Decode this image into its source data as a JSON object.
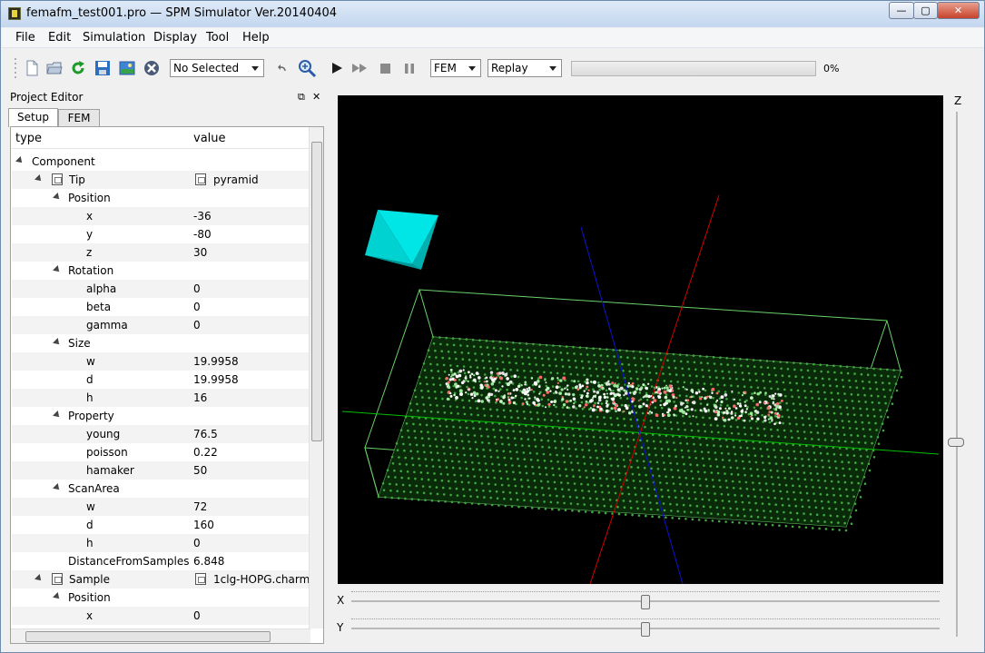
{
  "window": {
    "title": "femafm_test001.pro — SPM Simulator Ver.20140404",
    "minimize": "—",
    "maximize": "▢",
    "close": "✕"
  },
  "menu": [
    "File",
    "Edit",
    "Simulation",
    "Display",
    "Tool",
    "Help"
  ],
  "toolbar": {
    "selection_combo": "No Selected",
    "mode_combo": "FEM",
    "replay_combo": "Replay",
    "progress_percent": 0,
    "progress_label": "0%"
  },
  "project_editor": {
    "title": "Project Editor",
    "float_button": "⧉",
    "close_button": "✕",
    "tabs": [
      "Setup",
      "FEM"
    ],
    "columns": [
      "type",
      "value"
    ],
    "rows": [
      {
        "label": "Component",
        "value": ""
      },
      {
        "label": "Tip",
        "value": "pyramid"
      },
      {
        "label": "Position",
        "value": ""
      },
      {
        "label": "x",
        "value": "-36"
      },
      {
        "label": "y",
        "value": "-80"
      },
      {
        "label": "z",
        "value": "30"
      },
      {
        "label": "Rotation",
        "value": ""
      },
      {
        "label": "alpha",
        "value": "0"
      },
      {
        "label": "beta",
        "value": "0"
      },
      {
        "label": "gamma",
        "value": "0"
      },
      {
        "label": "Size",
        "value": ""
      },
      {
        "label": "w",
        "value": "19.9958"
      },
      {
        "label": "d",
        "value": "19.9958"
      },
      {
        "label": "h",
        "value": "16"
      },
      {
        "label": "Property",
        "value": ""
      },
      {
        "label": "young",
        "value": "76.5"
      },
      {
        "label": "poisson",
        "value": "0.22"
      },
      {
        "label": "hamaker",
        "value": "50"
      },
      {
        "label": "ScanArea",
        "value": ""
      },
      {
        "label": "w",
        "value": "72"
      },
      {
        "label": "d",
        "value": "160"
      },
      {
        "label": "h",
        "value": "0"
      },
      {
        "label": "DistanceFromSamples",
        "value": "6.848"
      },
      {
        "label": "Sample",
        "value": "1clg-HOPG.charm"
      },
      {
        "label": "Position",
        "value": ""
      },
      {
        "label": "x",
        "value": "0"
      }
    ]
  },
  "viewport": {
    "background": "#000000",
    "tip_color": "#00e5e5",
    "axis_colors": {
      "x": "#00c000",
      "y": "#d00000",
      "z": "#1010d0"
    },
    "box_color": "#6ad06a",
    "axes_labels": {
      "z": "Z",
      "x": "X",
      "y": "Y"
    }
  },
  "sliders": {
    "x_value": 0.5,
    "y_value": 0.5,
    "z_value": 0.62
  }
}
